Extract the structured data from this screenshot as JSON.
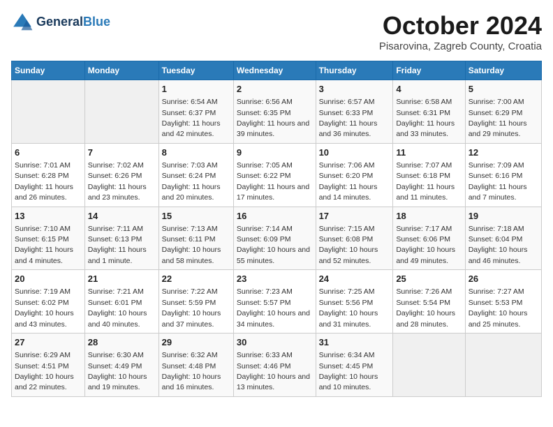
{
  "header": {
    "logo_line1": "General",
    "logo_line2": "Blue",
    "month": "October 2024",
    "location": "Pisarovina, Zagreb County, Croatia"
  },
  "days_of_week": [
    "Sunday",
    "Monday",
    "Tuesday",
    "Wednesday",
    "Thursday",
    "Friday",
    "Saturday"
  ],
  "weeks": [
    [
      {
        "day": "",
        "info": ""
      },
      {
        "day": "",
        "info": ""
      },
      {
        "day": "1",
        "info": "Sunrise: 6:54 AM\nSunset: 6:37 PM\nDaylight: 11 hours and 42 minutes."
      },
      {
        "day": "2",
        "info": "Sunrise: 6:56 AM\nSunset: 6:35 PM\nDaylight: 11 hours and 39 minutes."
      },
      {
        "day": "3",
        "info": "Sunrise: 6:57 AM\nSunset: 6:33 PM\nDaylight: 11 hours and 36 minutes."
      },
      {
        "day": "4",
        "info": "Sunrise: 6:58 AM\nSunset: 6:31 PM\nDaylight: 11 hours and 33 minutes."
      },
      {
        "day": "5",
        "info": "Sunrise: 7:00 AM\nSunset: 6:29 PM\nDaylight: 11 hours and 29 minutes."
      }
    ],
    [
      {
        "day": "6",
        "info": "Sunrise: 7:01 AM\nSunset: 6:28 PM\nDaylight: 11 hours and 26 minutes."
      },
      {
        "day": "7",
        "info": "Sunrise: 7:02 AM\nSunset: 6:26 PM\nDaylight: 11 hours and 23 minutes."
      },
      {
        "day": "8",
        "info": "Sunrise: 7:03 AM\nSunset: 6:24 PM\nDaylight: 11 hours and 20 minutes."
      },
      {
        "day": "9",
        "info": "Sunrise: 7:05 AM\nSunset: 6:22 PM\nDaylight: 11 hours and 17 minutes."
      },
      {
        "day": "10",
        "info": "Sunrise: 7:06 AM\nSunset: 6:20 PM\nDaylight: 11 hours and 14 minutes."
      },
      {
        "day": "11",
        "info": "Sunrise: 7:07 AM\nSunset: 6:18 PM\nDaylight: 11 hours and 11 minutes."
      },
      {
        "day": "12",
        "info": "Sunrise: 7:09 AM\nSunset: 6:16 PM\nDaylight: 11 hours and 7 minutes."
      }
    ],
    [
      {
        "day": "13",
        "info": "Sunrise: 7:10 AM\nSunset: 6:15 PM\nDaylight: 11 hours and 4 minutes."
      },
      {
        "day": "14",
        "info": "Sunrise: 7:11 AM\nSunset: 6:13 PM\nDaylight: 11 hours and 1 minute."
      },
      {
        "day": "15",
        "info": "Sunrise: 7:13 AM\nSunset: 6:11 PM\nDaylight: 10 hours and 58 minutes."
      },
      {
        "day": "16",
        "info": "Sunrise: 7:14 AM\nSunset: 6:09 PM\nDaylight: 10 hours and 55 minutes."
      },
      {
        "day": "17",
        "info": "Sunrise: 7:15 AM\nSunset: 6:08 PM\nDaylight: 10 hours and 52 minutes."
      },
      {
        "day": "18",
        "info": "Sunrise: 7:17 AM\nSunset: 6:06 PM\nDaylight: 10 hours and 49 minutes."
      },
      {
        "day": "19",
        "info": "Sunrise: 7:18 AM\nSunset: 6:04 PM\nDaylight: 10 hours and 46 minutes."
      }
    ],
    [
      {
        "day": "20",
        "info": "Sunrise: 7:19 AM\nSunset: 6:02 PM\nDaylight: 10 hours and 43 minutes."
      },
      {
        "day": "21",
        "info": "Sunrise: 7:21 AM\nSunset: 6:01 PM\nDaylight: 10 hours and 40 minutes."
      },
      {
        "day": "22",
        "info": "Sunrise: 7:22 AM\nSunset: 5:59 PM\nDaylight: 10 hours and 37 minutes."
      },
      {
        "day": "23",
        "info": "Sunrise: 7:23 AM\nSunset: 5:57 PM\nDaylight: 10 hours and 34 minutes."
      },
      {
        "day": "24",
        "info": "Sunrise: 7:25 AM\nSunset: 5:56 PM\nDaylight: 10 hours and 31 minutes."
      },
      {
        "day": "25",
        "info": "Sunrise: 7:26 AM\nSunset: 5:54 PM\nDaylight: 10 hours and 28 minutes."
      },
      {
        "day": "26",
        "info": "Sunrise: 7:27 AM\nSunset: 5:53 PM\nDaylight: 10 hours and 25 minutes."
      }
    ],
    [
      {
        "day": "27",
        "info": "Sunrise: 6:29 AM\nSunset: 4:51 PM\nDaylight: 10 hours and 22 minutes."
      },
      {
        "day": "28",
        "info": "Sunrise: 6:30 AM\nSunset: 4:49 PM\nDaylight: 10 hours and 19 minutes."
      },
      {
        "day": "29",
        "info": "Sunrise: 6:32 AM\nSunset: 4:48 PM\nDaylight: 10 hours and 16 minutes."
      },
      {
        "day": "30",
        "info": "Sunrise: 6:33 AM\nSunset: 4:46 PM\nDaylight: 10 hours and 13 minutes."
      },
      {
        "day": "31",
        "info": "Sunrise: 6:34 AM\nSunset: 4:45 PM\nDaylight: 10 hours and 10 minutes."
      },
      {
        "day": "",
        "info": ""
      },
      {
        "day": "",
        "info": ""
      }
    ]
  ]
}
